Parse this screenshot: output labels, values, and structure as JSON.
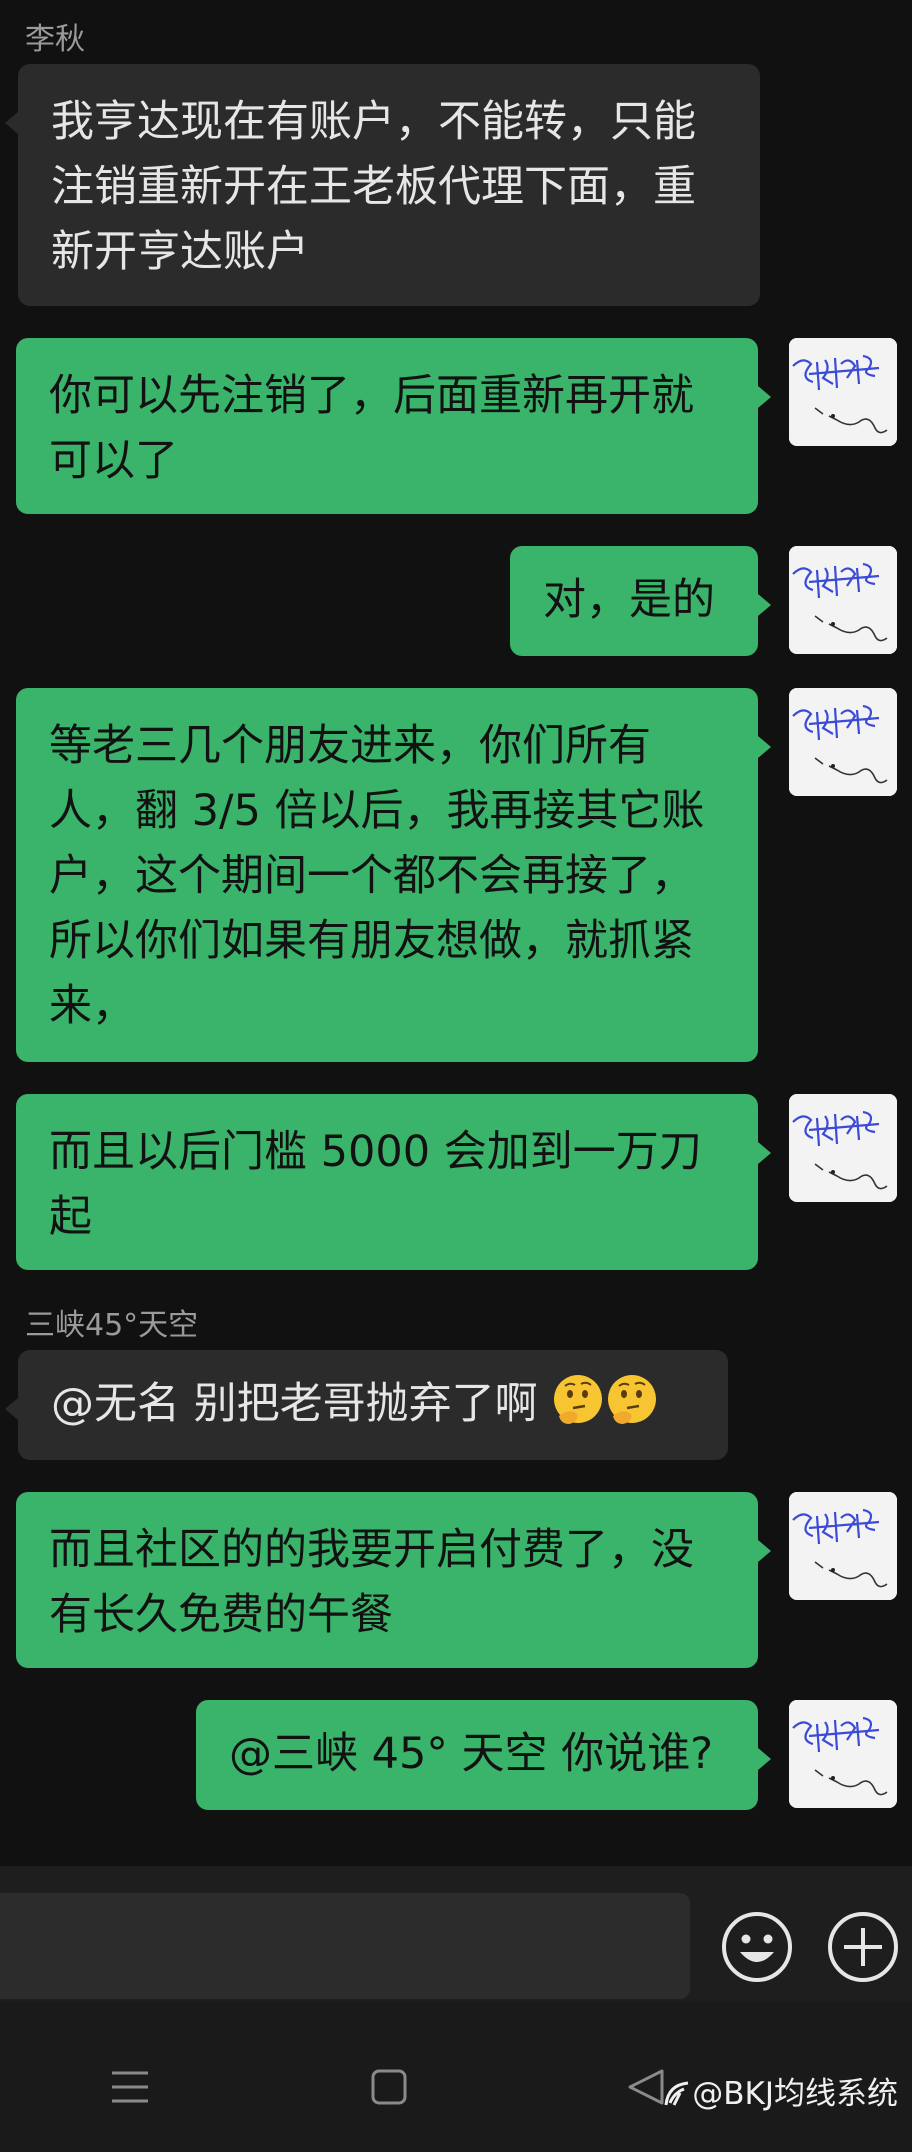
{
  "messages": [
    {
      "sender": "李秋",
      "text": "我亨达现在有账户，不能转，只能注销重新开在王老板代理下面，重新开亨达账户"
    },
    {
      "text": "你可以先注销了，后面重新再开就可以了"
    },
    {
      "text": "对，是的"
    },
    {
      "text": "等老三几个朋友进来，你们所有人，翻 3/5 倍以后，我再接其它账户，这个期间一个都不会再接了，所以你们如果有朋友想做，就抓紧来，"
    },
    {
      "text": "而且以后门槛 5000 会加到一万刀起"
    },
    {
      "sender": "三峡45°天空",
      "text": "@无名  别把老哥抛弃了啊"
    },
    {
      "text": "而且社区的的我要开启付费了，没有长久免费的午餐"
    },
    {
      "text": "@三峡 45° 天空  你说谁?"
    }
  ],
  "input": {
    "emoji_icon": "smiley-icon",
    "plus_icon": "plus-circle-icon"
  },
  "nav": {
    "menu_icon": "menu-icon",
    "home_icon": "square-icon",
    "back_icon": "back-triangle-icon"
  },
  "watermark": "@BKJ均线系统",
  "colors": {
    "background": "#111111",
    "incoming_bubble": "#2b2b2b",
    "outgoing_bubble": "#3ab36b",
    "sender_text": "#9a9a9a"
  }
}
